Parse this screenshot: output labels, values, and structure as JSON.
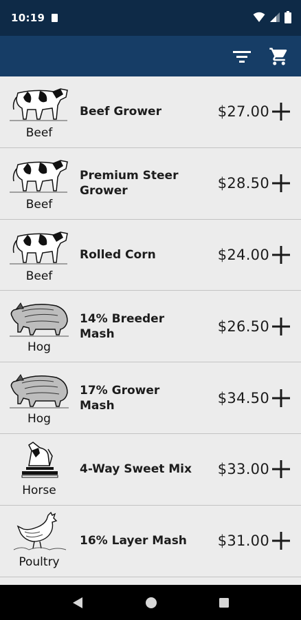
{
  "status": {
    "time": "10:19",
    "icons": [
      "sd-card-icon",
      "wifi-icon",
      "cell-signal-icon",
      "battery-icon"
    ]
  },
  "appbar": {
    "background": "#163d66",
    "actions": [
      "filter-icon",
      "cart-icon"
    ]
  },
  "products": [
    {
      "category": "Beef",
      "name": "Beef Grower",
      "price": "$27.00",
      "image": "cow"
    },
    {
      "category": "Beef",
      "name": "Premium Steer Grower",
      "price": "$28.50",
      "image": "cow"
    },
    {
      "category": "Beef",
      "name": "Rolled Corn",
      "price": "$24.00",
      "image": "cow"
    },
    {
      "category": "Hog",
      "name": "14% Breeder Mash",
      "price": "$26.50",
      "image": "hog"
    },
    {
      "category": "Hog",
      "name": "17% Grower Mash",
      "price": "$34.50",
      "image": "hog"
    },
    {
      "category": "Horse",
      "name": "4-Way Sweet Mix",
      "price": "$33.00",
      "image": "horse"
    },
    {
      "category": "Poultry",
      "name": "16% Layer Mash",
      "price": "$31.00",
      "image": "chicken"
    }
  ],
  "navbar": {
    "buttons": [
      "back-icon",
      "home-icon",
      "recents-icon"
    ]
  }
}
